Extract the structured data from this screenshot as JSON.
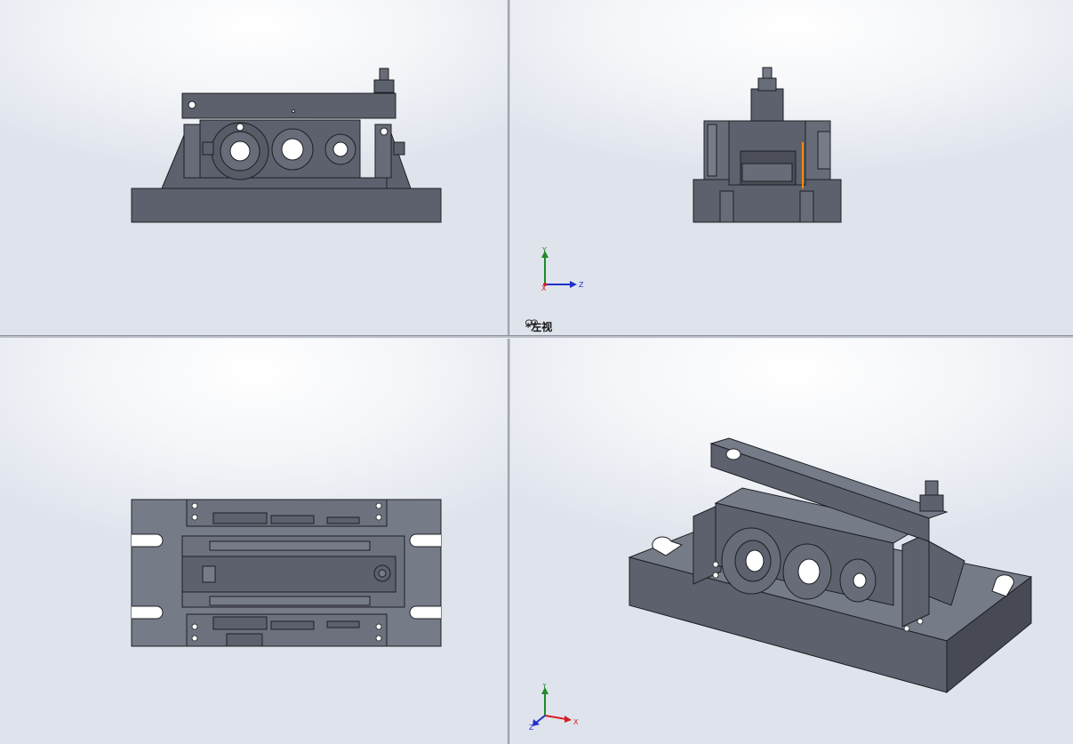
{
  "viewports": [
    {
      "id": "front",
      "label": ""
    },
    {
      "id": "left",
      "label": "*左视"
    },
    {
      "id": "top",
      "label": ""
    },
    {
      "id": "isometric",
      "label": ""
    }
  ],
  "triad_left": {
    "y": "Y",
    "z": "Z",
    "x": "X"
  },
  "triad_iso": {
    "y": "Y",
    "z": "Z",
    "x": "X"
  },
  "colors": {
    "part_face": "#5d616d",
    "part_light": "#767b88",
    "part_dark": "#3f424b",
    "edge": "#1d1f24",
    "axis_x": "#d42020",
    "axis_y": "#1f8a2a",
    "axis_z": "#2030c8",
    "highlight": "#ff8a00"
  },
  "icons": {
    "view_link": "link-icon"
  }
}
